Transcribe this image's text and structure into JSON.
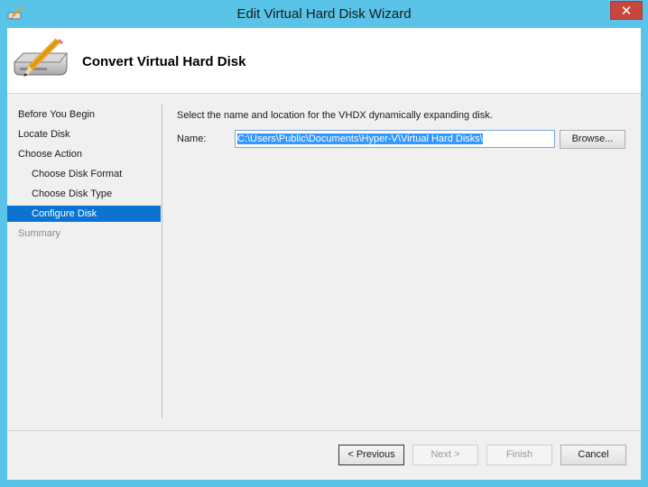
{
  "window": {
    "title": "Edit Virtual Hard Disk Wizard",
    "close_label": "✕"
  },
  "header": {
    "title": "Convert Virtual Hard Disk"
  },
  "nav": {
    "items": [
      {
        "label": "Before You Begin"
      },
      {
        "label": "Locate Disk"
      },
      {
        "label": "Choose Action"
      },
      {
        "label": "Choose Disk Format"
      },
      {
        "label": "Choose Disk Type"
      },
      {
        "label": "Configure Disk"
      },
      {
        "label": "Summary"
      }
    ]
  },
  "main": {
    "instruction": "Select the name and location for the VHDX dynamically expanding disk.",
    "name_label": "Name:",
    "name_value": "C:\\Users\\Public\\Documents\\Hyper-V\\Virtual Hard Disks\\",
    "browse_label": "Browse..."
  },
  "buttons": {
    "previous": "< Previous",
    "next": "Next >",
    "finish": "Finish",
    "cancel": "Cancel"
  }
}
